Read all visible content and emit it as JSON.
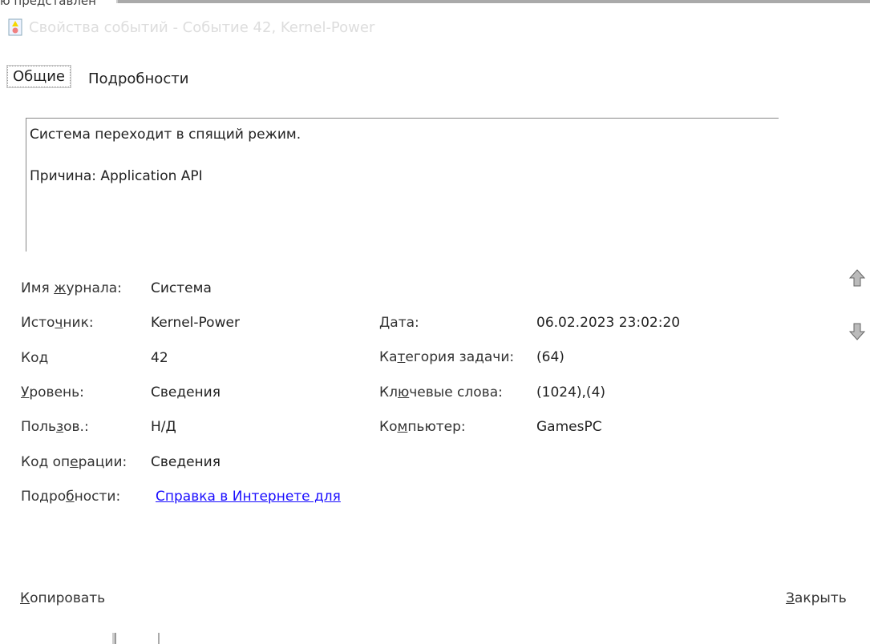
{
  "background_window": {
    "cut_text": "ю представлен"
  },
  "window": {
    "title": "Свойства событий - Событие 42, Kernel-Power",
    "icon": "event-warning-icon"
  },
  "tabs": [
    {
      "label": "Общие",
      "active": true
    },
    {
      "label": "Подробности",
      "active": false
    }
  ],
  "message": {
    "line1": "Система переходит в спящий режим.",
    "line2": "Причина: Application API"
  },
  "fields_left": [
    {
      "label": [
        "Имя ",
        "ж",
        "урнала:"
      ],
      "value": "Система"
    },
    {
      "label": [
        "Исто",
        "ч",
        "ник:"
      ],
      "value": "Kernel-Power"
    },
    {
      "label": [
        "Код",
        "",
        ""
      ],
      "value": "42"
    },
    {
      "label": [
        "",
        "У",
        "ровень:"
      ],
      "value": "Сведения"
    },
    {
      "label": [
        "Поль",
        "з",
        "ов.:"
      ],
      "value": "Н/Д"
    },
    {
      "label": [
        "Код оп",
        "е",
        "рации:"
      ],
      "value": "Сведения"
    },
    {
      "label": [
        "Подро",
        "б",
        "ности:"
      ],
      "value": "Справка в Интернете для "
    }
  ],
  "fields_right": [
    {
      "label": [
        "",
        "Д",
        "ата:"
      ],
      "value": "06.02.2023 23:02:20"
    },
    {
      "label": [
        "Ка",
        "т",
        "егория задачи:"
      ],
      "value": "(64)"
    },
    {
      "label": [
        "Кл",
        "ю",
        "чевые слова:"
      ],
      "value": "(1024),(4)"
    },
    {
      "label": [
        "Ко",
        "м",
        "пьютер:"
      ],
      "value": "GamesPC"
    }
  ],
  "nav": {
    "up_icon": "arrow-up-icon",
    "down_icon": "arrow-down-icon"
  },
  "buttons": {
    "copy": [
      "К",
      "опировать"
    ],
    "close": [
      "З",
      "акрыть"
    ]
  }
}
